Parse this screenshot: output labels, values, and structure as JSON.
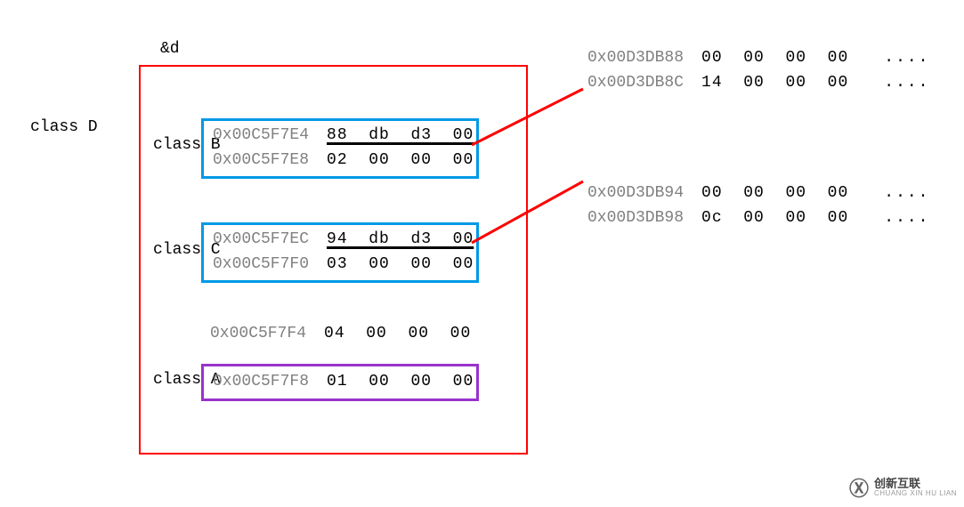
{
  "top_label": "&d",
  "outer_label": "class D",
  "classB": {
    "label": "class B",
    "addr1": "0x00C5F7E4",
    "bytes1": "88  db  d3  00",
    "addr2": "0x00C5F7E8",
    "bytes2": "02  00  00  00"
  },
  "classC": {
    "label": "class C",
    "addr1": "0x00C5F7EC",
    "bytes1": "94  db  d3  00",
    "addr2": "0x00C5F7F0",
    "bytes2": "03  00  00  00"
  },
  "below_boxes": {
    "addr1": "0x00C5F7F4",
    "bytes1": "04  00  00  00"
  },
  "classA": {
    "label": "class A",
    "addr1": "0x00C5F7F8",
    "bytes1": "01  00  00  00"
  },
  "ext1": {
    "addr1": "0x00D3DB88",
    "bytes1": "00  00  00  00",
    "dots1": "....",
    "addr2": "0x00D3DB8C",
    "bytes2": "14  00  00  00",
    "dots2": "...."
  },
  "ext2": {
    "addr1": "0x00D3DB94",
    "bytes1": "00  00  00  00",
    "dots1": "....",
    "addr2": "0x00D3DB98",
    "bytes2": "0c  00  00  00",
    "dots2": "...."
  },
  "watermark": {
    "brand": "创新互联",
    "sub": "CHUANG XIN HU LIAN"
  }
}
